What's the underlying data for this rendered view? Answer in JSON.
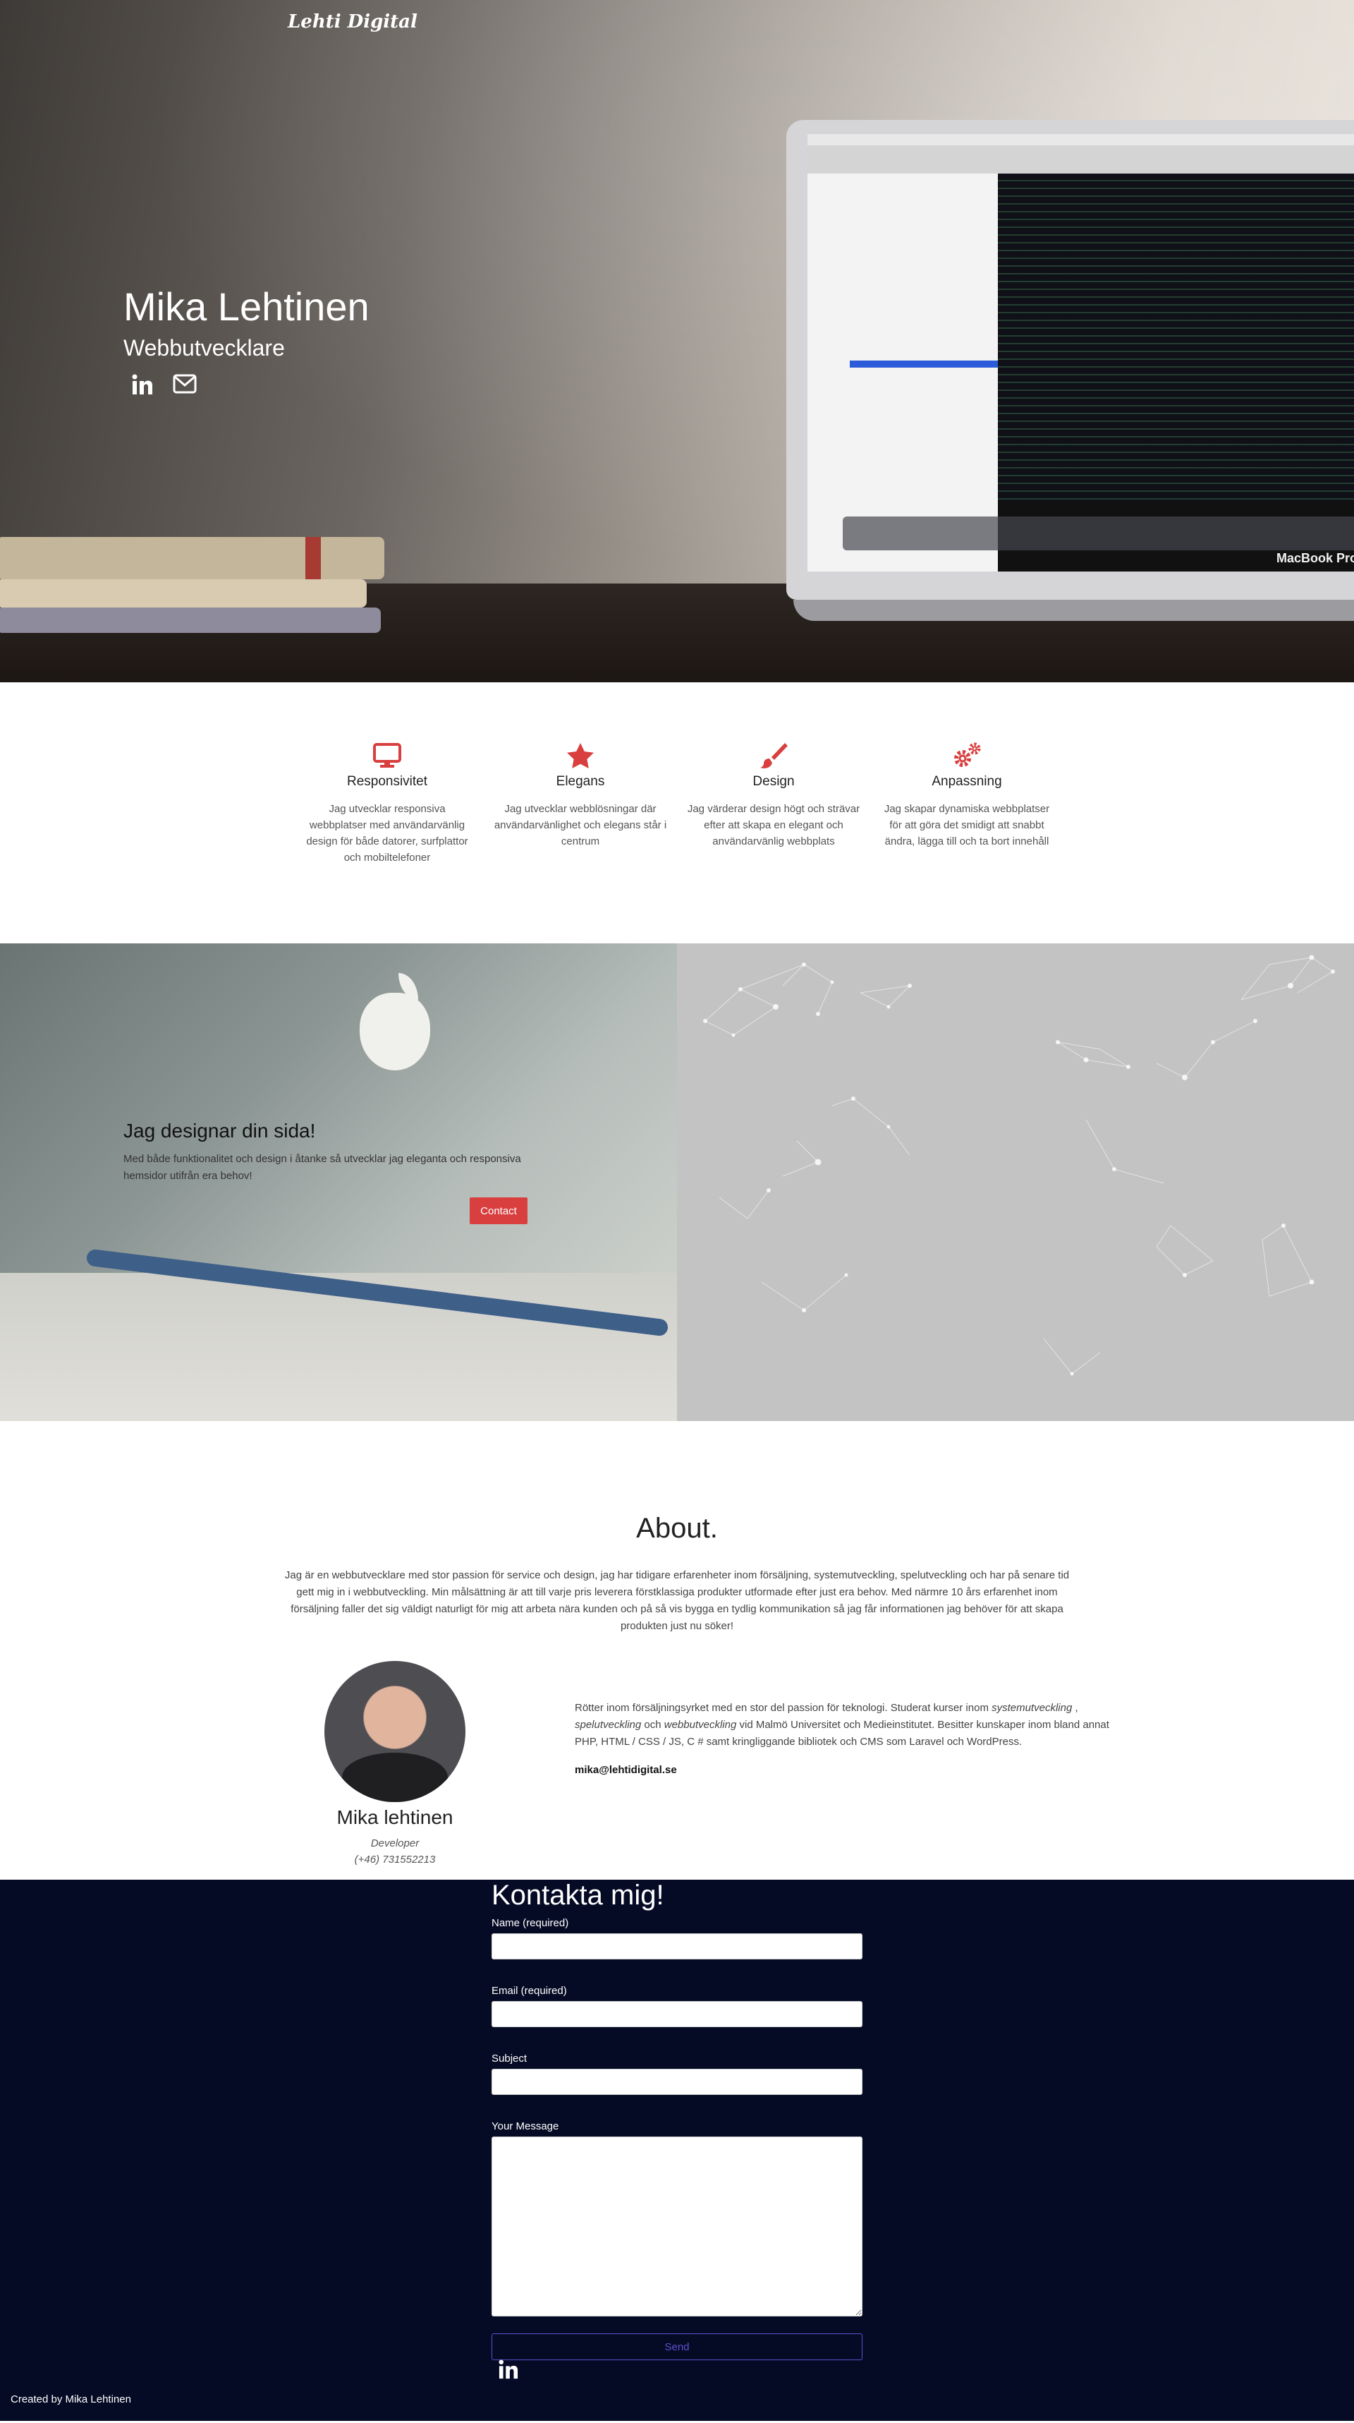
{
  "hero": {
    "logo": "Lehti Digital",
    "name": "Mika Lehtinen",
    "role": "Webbutvecklare",
    "social": [
      "linkedin-icon",
      "mail-icon"
    ],
    "laptop_label": "MacBook Pro"
  },
  "features": [
    {
      "icon": "desktop-icon",
      "title": "Responsivitet",
      "text": "Jag utvecklar responsiva webbplatser med användarvänlig design för både datorer, surfplattor och mobiltelefoner"
    },
    {
      "icon": "star-icon",
      "title": "Elegans",
      "text": "Jag utvecklar webblösningar där användarvänlighet och elegans står i centrum"
    },
    {
      "icon": "brush-icon",
      "title": "Design",
      "text": "Jag värderar design högt och strävar efter att skapa en elegant och användarvänlig webbplats"
    },
    {
      "icon": "gears-icon",
      "title": "Anpassning",
      "text": "Jag skapar dynamiska webbplatser för att göra det smidigt att snabbt ändra, lägga till och ta bort innehåll"
    }
  ],
  "colors": {
    "accent": "#d93f3f",
    "contact_bg": "#050b25",
    "send": "#5d4fd0"
  },
  "split": {
    "heading": "Jag designar din sida!",
    "text": "Med både funktionalitet och design i åtanke så utvecklar jag eleganta och responsiva hemsidor utifrån era behov!",
    "button": "Contact"
  },
  "about": {
    "title": "About.",
    "intro": "Jag är en webbutvecklare med stor passion för service och design, jag har tidigare erfarenheter inom försäljning, systemutveckling, spelutveckling och har på senare tid gett mig in i webbutveckling. Min målsättning är att till varje pris leverera förstklassiga produkter utformade efter just era behov. Med närmre 10 års erfarenhet inom försäljning faller det sig väldigt naturligt för mig att arbeta nära kunden och på så vis bygga en tydlig kommunikation så jag får informationen jag behöver för att skapa produkten just nu söker!",
    "profile_name": "Mika lehtinen",
    "profile_role": "Developer",
    "profile_phone": "(+46) 731552213",
    "bio_a": "Rötter inom försäljningsyrket med en stor del passion för teknologi. Studerat kurser inom ",
    "bio_em1": "systemutveckling",
    "bio_b": " , ",
    "bio_em2": "spelutveckling",
    "bio_c": " och ",
    "bio_em3": "webbutveckling",
    "bio_d": " vid Malmö Universitet och Medieinstitutet. Besitter kunskaper inom bland annat PHP, HTML / CSS / JS, C # samt kringliggande bibliotek och CMS som Laravel och WordPress.",
    "email": "mika@lehtidigital.se"
  },
  "contact": {
    "title": "Kontakta mig!",
    "name_label": "Name (required)",
    "email_label": "Email (required)",
    "subject_label": "Subject",
    "message_label": "Your Message",
    "send": "Send",
    "credit": "Created by Mika Lehtinen"
  }
}
